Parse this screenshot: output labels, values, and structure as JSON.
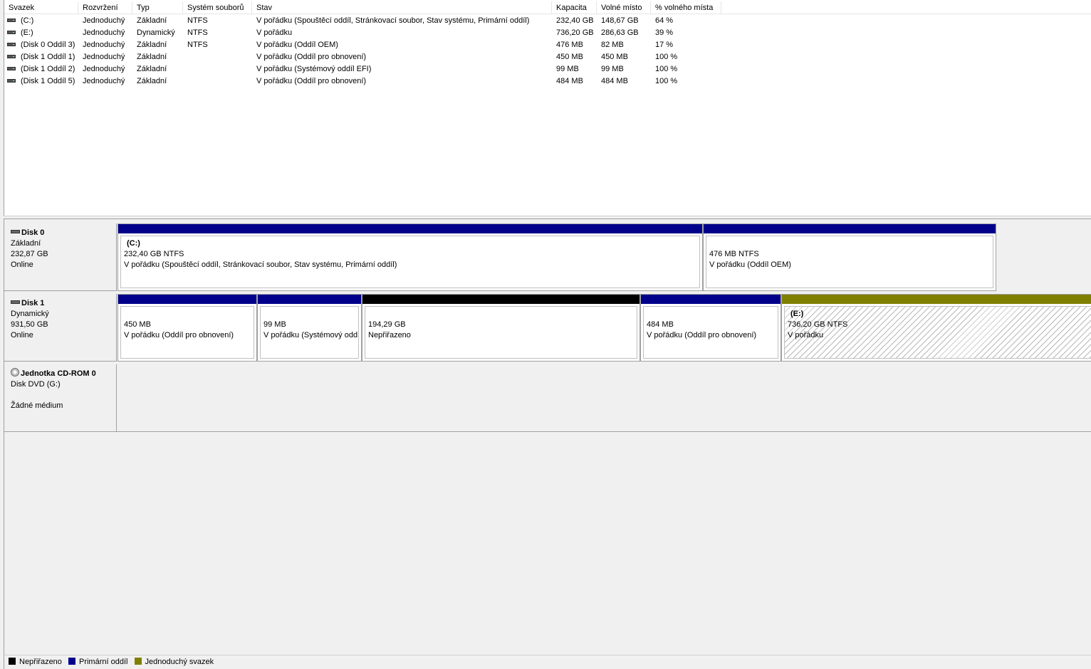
{
  "columns": [
    "Svazek",
    "Rozvržení",
    "Typ",
    "Systém souborů",
    "Stav",
    "Kapacita",
    "Volné místo",
    "% volného místa"
  ],
  "volumes": [
    {
      "name": "(C:)",
      "layout": "Jednoduchý",
      "type": "Základní",
      "fs": "NTFS",
      "status": "V pořádku (Spouštěcí oddíl, Stránkovací soubor, Stav systému, Primární oddíl)",
      "capacity": "232,40 GB",
      "free": "148,67 GB",
      "pct": "64 %"
    },
    {
      "name": "(E:)",
      "layout": "Jednoduchý",
      "type": "Dynamický",
      "fs": "NTFS",
      "status": "V pořádku",
      "capacity": "736,20 GB",
      "free": "286,63 GB",
      "pct": "39 %"
    },
    {
      "name": "(Disk 0 Oddíl 3)",
      "layout": "Jednoduchý",
      "type": "Základní",
      "fs": "NTFS",
      "status": "V pořádku (Oddíl OEM)",
      "capacity": "476 MB",
      "free": "82 MB",
      "pct": "17 %"
    },
    {
      "name": "(Disk 1 Oddíl 1)",
      "layout": "Jednoduchý",
      "type": "Základní",
      "fs": "",
      "status": "V pořádku (Oddíl pro obnovení)",
      "capacity": "450 MB",
      "free": "450 MB",
      "pct": "100 %"
    },
    {
      "name": "(Disk 1 Oddíl 2)",
      "layout": "Jednoduchý",
      "type": "Základní",
      "fs": "",
      "status": "V pořádku (Systémový oddíl EFI)",
      "capacity": "99 MB",
      "free": "99 MB",
      "pct": "100 %"
    },
    {
      "name": "(Disk 1 Oddíl 5)",
      "layout": "Jednoduchý",
      "type": "Základní",
      "fs": "",
      "status": "V pořádku (Oddíl pro obnovení)",
      "capacity": "484 MB",
      "free": "484 MB",
      "pct": "100 %"
    }
  ],
  "disks": [
    {
      "name": "Disk 0",
      "type": "Základní",
      "size": "232,87 GB",
      "state": "Online",
      "partitions": [
        {
          "label": "(C:)",
          "line1": "232,40 GB NTFS",
          "line2": "V pořádku (Spouštěcí oddíl, Stránkovací soubor, Stav systému, Primární oddíl)",
          "kind": "primary"
        },
        {
          "label": "",
          "line1": "476 MB NTFS",
          "line2": "V pořádku (Oddíl OEM)",
          "kind": "primary"
        }
      ]
    },
    {
      "name": "Disk 1",
      "type": "Dynamický",
      "size": "931,50 GB",
      "state": "Online",
      "partitions": [
        {
          "label": "",
          "line1": "450 MB",
          "line2": "V pořádku (Oddíl pro obnovení)",
          "kind": "primary"
        },
        {
          "label": "",
          "line1": "99 MB",
          "line2": "V pořádku (Systémový oddíl EFI)",
          "kind": "primary"
        },
        {
          "label": "",
          "line1": "194,29 GB",
          "line2": "Nepřiřazeno",
          "kind": "unallocated"
        },
        {
          "label": "",
          "line1": "484 MB",
          "line2": "V pořádku (Oddíl pro obnovení)",
          "kind": "primary"
        },
        {
          "label": "(E:)",
          "line1": "736,20 GB NTFS",
          "line2": "V pořádku",
          "kind": "simple"
        }
      ]
    }
  ],
  "cdrom": {
    "name": "Jednotka CD-ROM 0",
    "type": "Disk DVD (G:)",
    "media": "Žádné médium"
  },
  "legend": [
    {
      "label": "Nepřiřazeno",
      "color": "#000000"
    },
    {
      "label": "Primární oddíl",
      "color": "#00008b"
    },
    {
      "label": "Jednoduchý svazek",
      "color": "#808000"
    }
  ],
  "colors": {
    "primary": "#00008b",
    "unallocated": "#000000",
    "simple": "#808000"
  }
}
